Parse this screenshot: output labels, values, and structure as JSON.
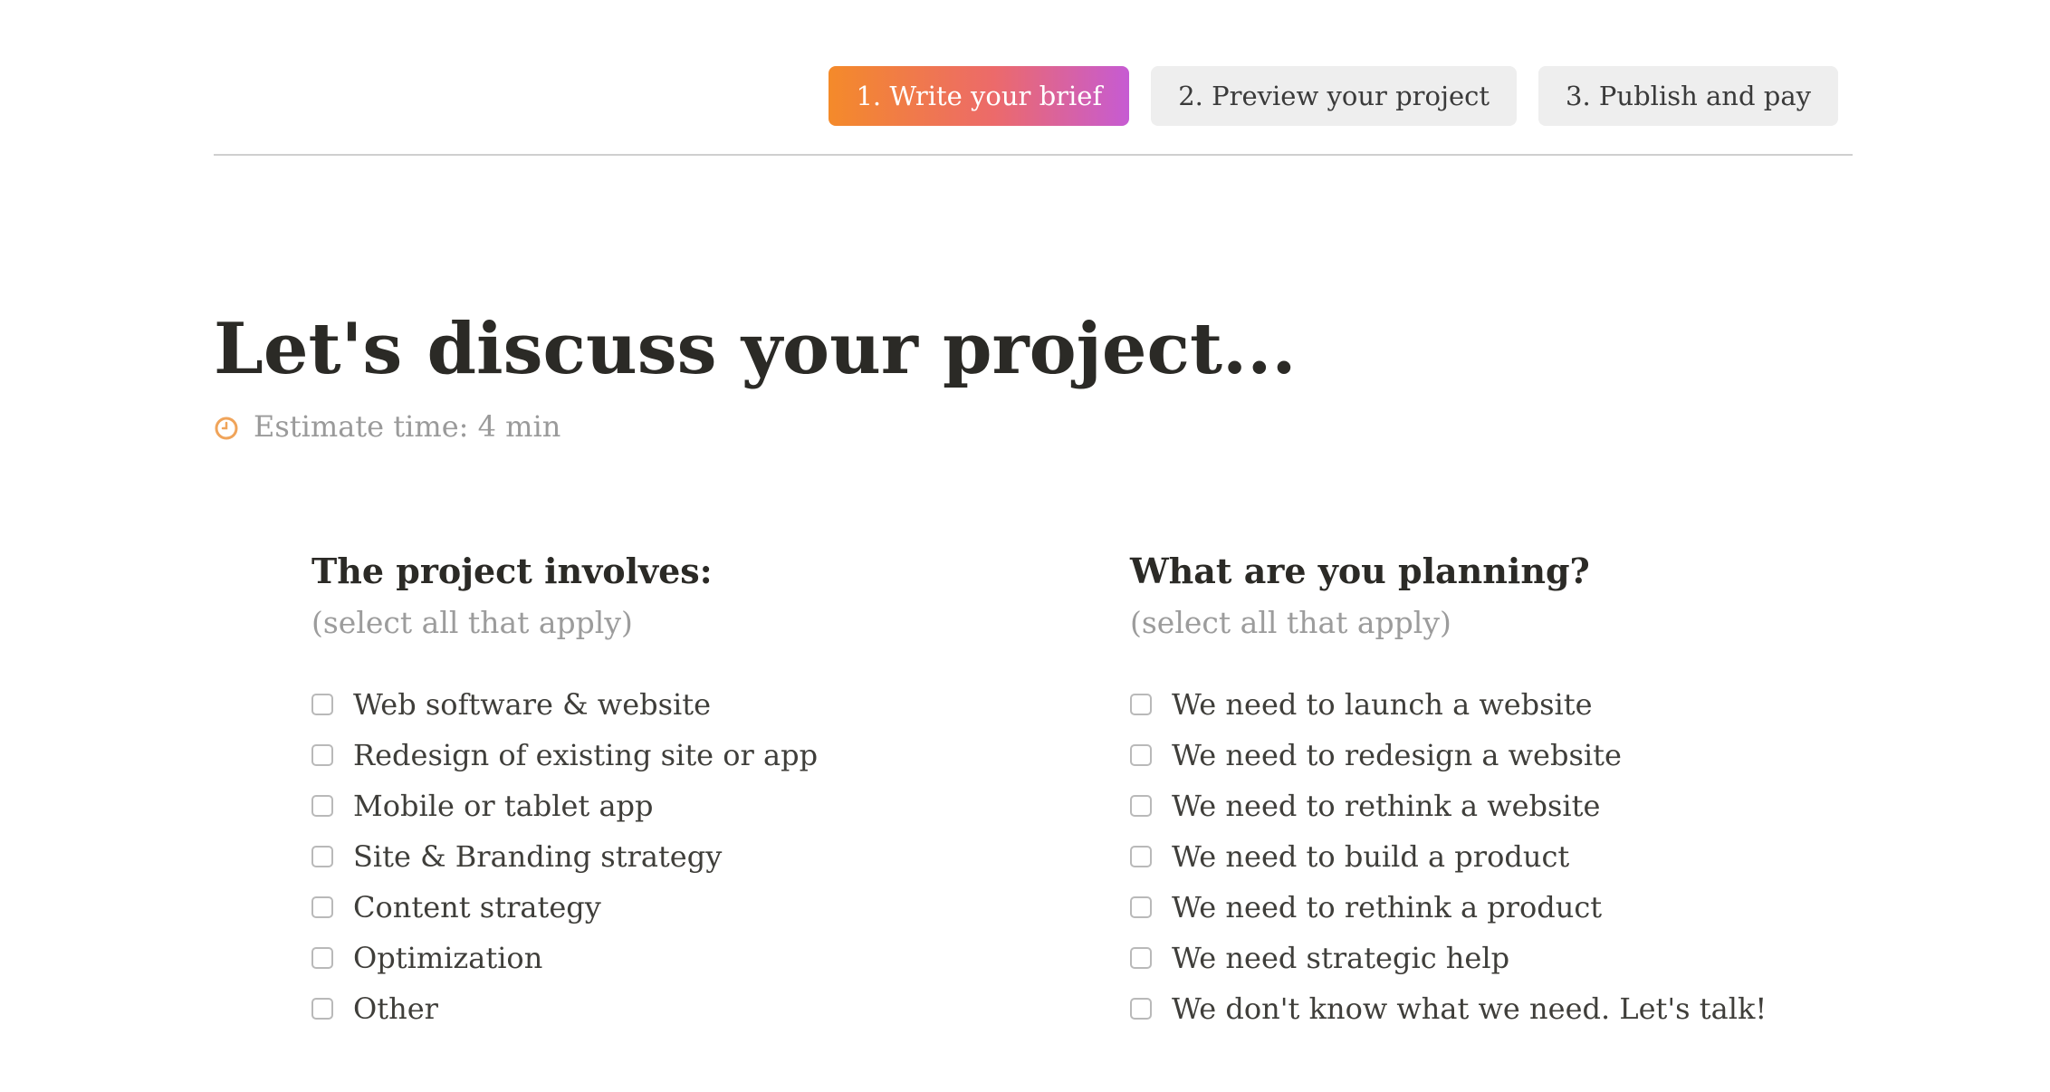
{
  "steps": [
    {
      "label": "1. Write your brief",
      "active": true
    },
    {
      "label": "2. Preview your project",
      "active": false
    },
    {
      "label": "3. Publish and pay",
      "active": false
    }
  ],
  "header": {
    "title": "Let's discuss your project...",
    "estimate": "Estimate time: 4 min",
    "estimate_icon": "clock-icon",
    "accent_color": "#f0a45a"
  },
  "left_column": {
    "heading": "The project involves:",
    "hint": "(select all that apply)",
    "options": [
      "Web software & website",
      "Redesign of existing site or app",
      "Mobile or tablet app",
      "Site & Branding strategy",
      "Content strategy",
      "Optimization",
      "Other"
    ]
  },
  "right_column": {
    "heading": "What are you planning?",
    "hint": "(select all that apply)",
    "options": [
      "We need to launch a website",
      "We need to redesign a website",
      "We need to rethink a website",
      "We need to build a product",
      "We need to rethink a product",
      "We need strategic help",
      "We don't know what we need. Let's talk!"
    ]
  }
}
